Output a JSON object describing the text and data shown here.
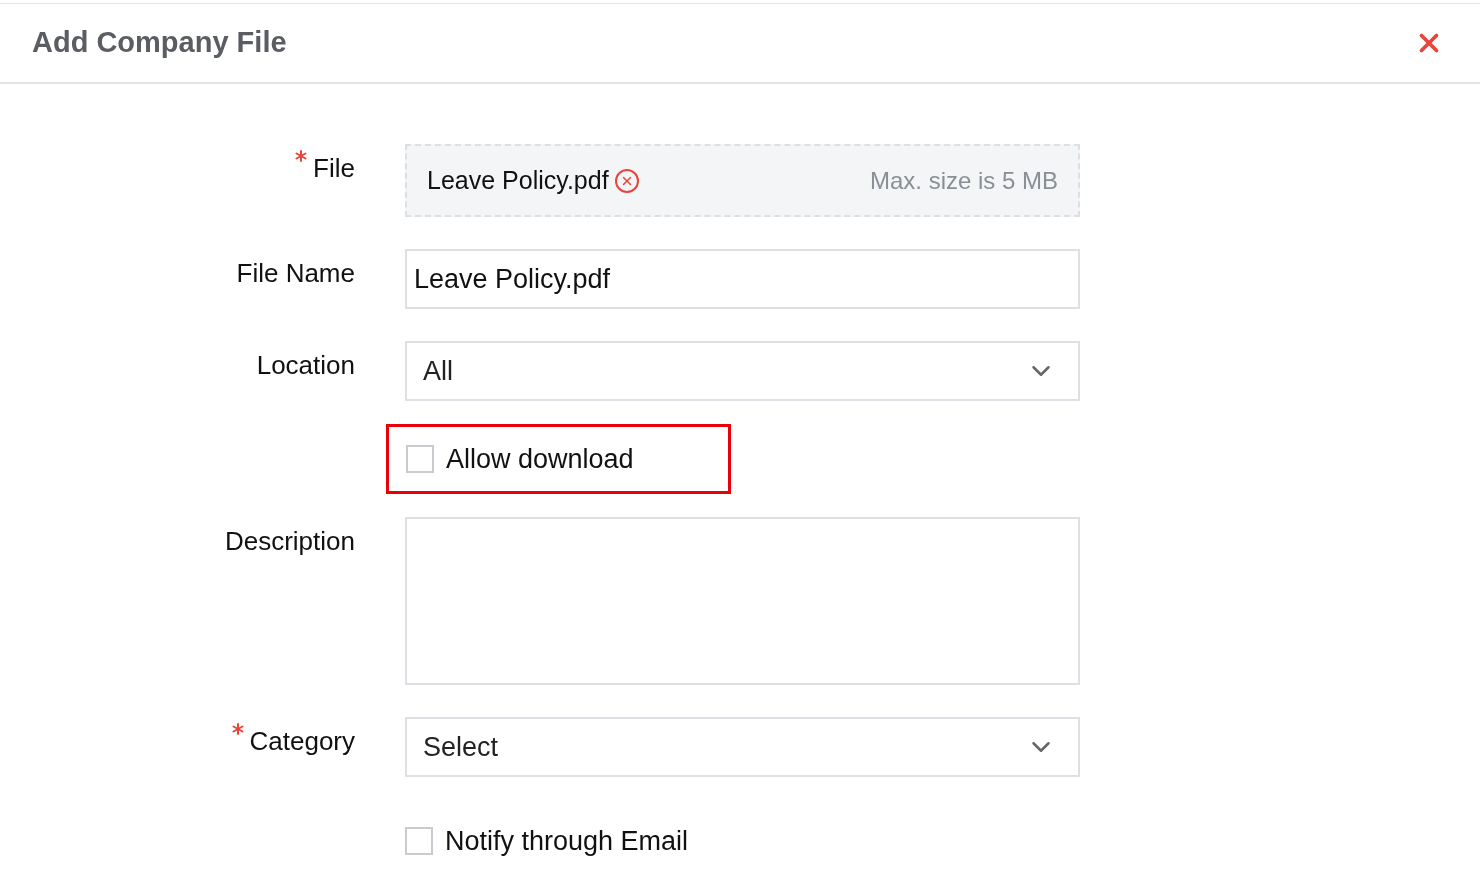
{
  "dialog": {
    "title": "Add Company File"
  },
  "fields": [
    {
      "kind": "file",
      "label": "File",
      "required": true,
      "filename": "Leave Policy.pdf",
      "hint": "Max. size is 5 MB"
    },
    {
      "kind": "text",
      "label": "File Name",
      "required": false,
      "value": "Leave Policy.pdf"
    },
    {
      "kind": "select",
      "label": "Location",
      "required": false,
      "value": "All"
    },
    {
      "kind": "checkbox",
      "label": "Allow download",
      "checked": false,
      "highlighted": true
    },
    {
      "kind": "textarea",
      "label": "Description",
      "required": false
    },
    {
      "kind": "select",
      "label": "Category",
      "required": true,
      "value": "Select"
    },
    {
      "kind": "checkbox",
      "label": "Notify through Email",
      "checked": false,
      "highlighted": false
    }
  ]
}
